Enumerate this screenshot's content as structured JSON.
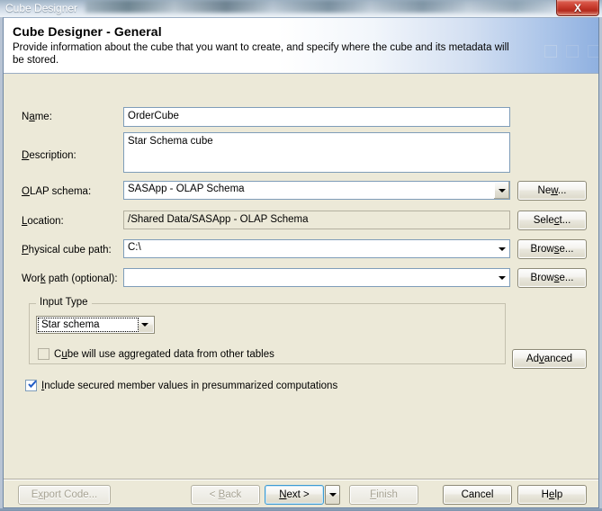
{
  "window": {
    "title": "Cube Designer",
    "close_label": "X"
  },
  "header": {
    "title": "Cube Designer - General",
    "description": "Provide information about the cube that you want to create, and specify where the cube and its metadata will be stored."
  },
  "form": {
    "name": {
      "label_pre": "N",
      "label_mn": "a",
      "label_post": "me:",
      "value": "OrderCube",
      "placeholder": ""
    },
    "description": {
      "label_pre": "",
      "label_mn": "D",
      "label_post": "escription:",
      "value": "Star Schema cube",
      "placeholder": ""
    },
    "olap_schema": {
      "label_pre": "",
      "label_mn": "O",
      "label_post": "LAP schema:",
      "value": "SASApp - OLAP Schema",
      "button": "New...",
      "button_pre": "Ne",
      "button_mn": "w",
      "button_post": "..."
    },
    "location": {
      "label_pre": "",
      "label_mn": "L",
      "label_post": "ocation:",
      "value": "/Shared Data/SASApp - OLAP Schema",
      "button": "Select...",
      "button_pre": "Sele",
      "button_mn": "c",
      "button_post": "t..."
    },
    "physical_cube_path": {
      "label_pre": "",
      "label_mn": "P",
      "label_post": "hysical cube path:",
      "value": "C:\\",
      "button": "Browse...",
      "button_pre": "Brow",
      "button_mn": "s",
      "button_post": "e..."
    },
    "work_path": {
      "label_pre": "Wor",
      "label_mn": "k",
      "label_post": " path (optional):",
      "value": "",
      "button": "Browse...",
      "button_pre": "Brow",
      "button_mn": "s",
      "button_post": "e..."
    }
  },
  "input_type_group": {
    "legend": "Input Type",
    "combo_value": "Star schema",
    "checkbox": {
      "label_pre": "C",
      "label_mn": "u",
      "label_post": "be will use aggregated data from other tables",
      "checked": false,
      "enabled": false
    },
    "advanced_button": {
      "label": "Advanced",
      "pre": "Ad",
      "mn": "v",
      "post": "anced"
    }
  },
  "secured_checkbox": {
    "label_pre": "",
    "label_mn": "I",
    "label_post": "nclude secured member values in presummarized computations",
    "checked": true
  },
  "footer": {
    "export_code": {
      "label": "Export Code...",
      "pre": "E",
      "mn": "x",
      "post": "port Code...",
      "enabled": false
    },
    "back": {
      "label": "< Back",
      "pre": "< ",
      "mn": "B",
      "post": "ack",
      "enabled": false
    },
    "next": {
      "label": "Next >",
      "pre": "",
      "mn": "N",
      "post": "ext >",
      "enabled": true
    },
    "next_dropdown_icon": "chevron-down-icon",
    "finish": {
      "label": "Finish",
      "pre": "",
      "mn": "F",
      "post": "inish",
      "enabled": false
    },
    "cancel": {
      "label": "Cancel",
      "pre": "Cancel",
      "mn": "",
      "post": "",
      "enabled": true
    },
    "help": {
      "label": "Help",
      "pre": "H",
      "mn": "e",
      "post": "lp",
      "enabled": true
    }
  },
  "colors": {
    "dialog_face": "#ece9d8",
    "field_border": "#7f9db9",
    "accent_blue": "#3c9ad1",
    "close_red": "#c63a2b",
    "disabled_text": "#a7a393"
  }
}
